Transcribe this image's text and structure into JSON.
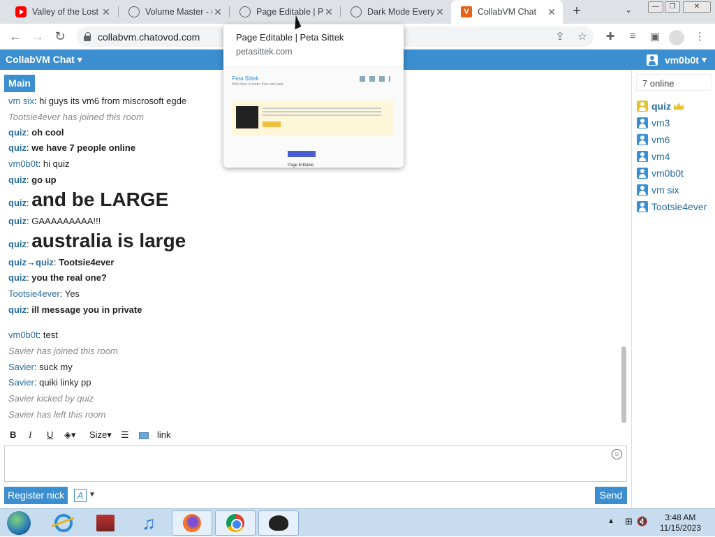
{
  "browser": {
    "tabs": [
      {
        "title": "Valley of the Lost",
        "icon": "youtube-icon",
        "active": false
      },
      {
        "title": "Volume Master - (",
        "icon": "globe-icon",
        "active": false
      },
      {
        "title": "Page Editable | Pe",
        "icon": "globe-icon",
        "active": false
      },
      {
        "title": "Dark Mode Everyw",
        "icon": "globe-icon",
        "active": false
      },
      {
        "title": "CollabVM Chat",
        "icon": "collabvm-icon",
        "active": true
      }
    ],
    "url": "collabvm.chatovod.com",
    "tooltip": {
      "title": "Page Editable | Peta Sittek",
      "domain": "petasittek.com",
      "preview_name": "Peta Sittek",
      "preview_tag": "Well done is better than well said.",
      "preview_footer": "Page Editable"
    }
  },
  "app": {
    "title": "CollabVM Chat",
    "current_user": "vm0b0t",
    "room_tab": "Main",
    "online_count": "7 online"
  },
  "messages": [
    {
      "nick": "vm six",
      "text": "hi guys its vm6 from miscrosoft egde",
      "type": "user"
    },
    {
      "text": "Tootsie4ever has joined this room",
      "type": "system"
    },
    {
      "nick": "quiz",
      "text": "oh cool",
      "type": "admin"
    },
    {
      "nick": "quiz",
      "text": "we have 7 people online",
      "type": "admin"
    },
    {
      "nick": "vm0b0t",
      "text": "hi quiz",
      "type": "user"
    },
    {
      "nick": "quiz",
      "text": "go up",
      "type": "admin"
    },
    {
      "nick": "quiz",
      "text": "and be LARGE",
      "type": "admin-big"
    },
    {
      "nick": "quiz",
      "text": "GAAAAAAAAA!!!",
      "type": "admin-normal"
    },
    {
      "nick": "quiz",
      "text": "australia is large",
      "type": "admin-big"
    },
    {
      "nick": "quiz",
      "to": "quiz",
      "text": "Tootsie4ever",
      "type": "private"
    },
    {
      "nick": "quiz",
      "text": "you the real one?",
      "type": "admin"
    },
    {
      "nick": "Tootsie4ever",
      "text": "Yes",
      "type": "user"
    },
    {
      "nick": "quiz",
      "text": "ill message you in private",
      "type": "admin"
    },
    {
      "nick": "vm0b0t",
      "text": "test",
      "type": "user"
    },
    {
      "text": "Savier has joined this room",
      "type": "system"
    },
    {
      "nick": "Savier",
      "text": "suck my",
      "type": "user"
    },
    {
      "nick": "Savier",
      "text": "quiki linky pp",
      "type": "user"
    },
    {
      "text": "Savier kicked by quiz",
      "type": "system"
    },
    {
      "text": "Savier has left this room",
      "type": "system"
    }
  ],
  "users": [
    {
      "name": "quiz",
      "role": "admin"
    },
    {
      "name": "vm3",
      "role": "user"
    },
    {
      "name": "vm6",
      "role": "user"
    },
    {
      "name": "vm4",
      "role": "user"
    },
    {
      "name": "vm0b0t",
      "role": "user"
    },
    {
      "name": "vm six",
      "role": "user"
    },
    {
      "name": "Tootsie4ever",
      "role": "user"
    }
  ],
  "format_toolbar": {
    "bold": "B",
    "italic": "I",
    "underline": "U",
    "size": "Size",
    "link": "link"
  },
  "composer": {
    "register_label": "Register nick",
    "font_label": "A",
    "send_label": "Send"
  },
  "taskbar": {
    "time": "3:48 AM",
    "date": "11/15/2023"
  },
  "colors": {
    "accent": "#3b8fd0",
    "nick": "#286d9e",
    "system_text": "#888888"
  }
}
